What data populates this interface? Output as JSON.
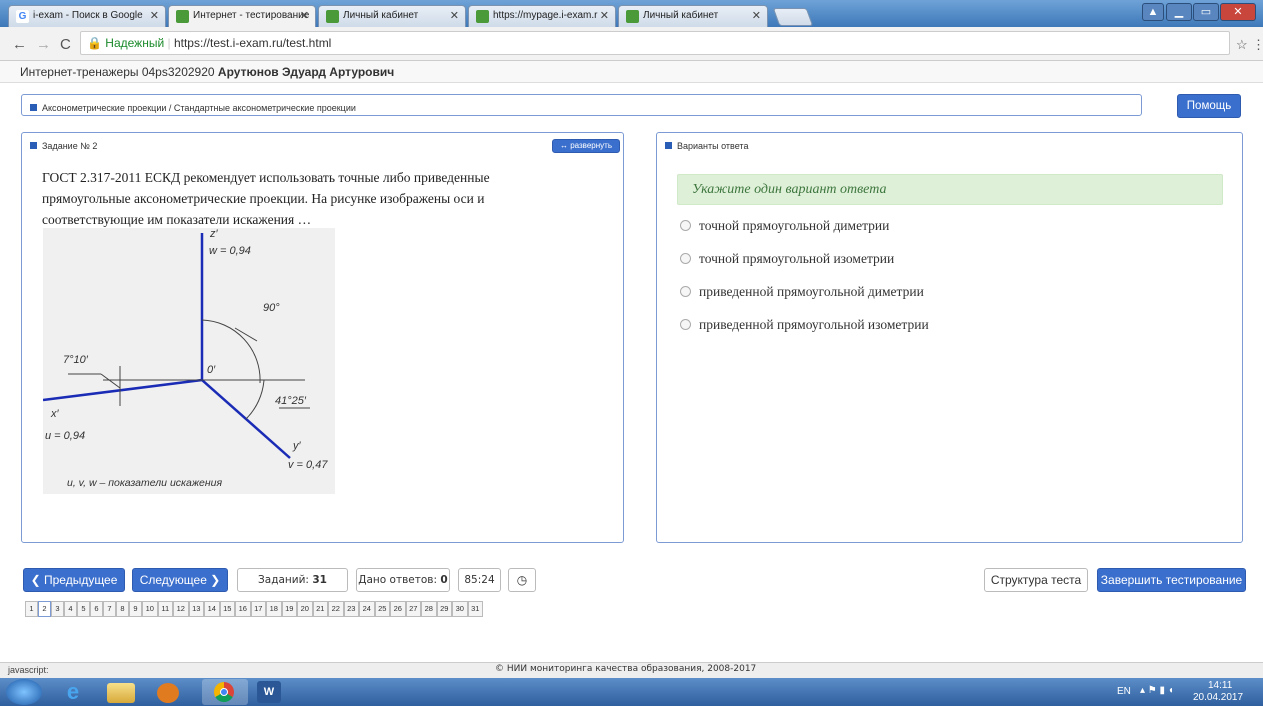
{
  "browser": {
    "tabs": [
      {
        "label": "i-exam - Поиск в Google"
      },
      {
        "label": "Интернет - тестирование"
      },
      {
        "label": "Личный кабинет"
      },
      {
        "label": "https://mypage.i-exam.r"
      },
      {
        "label": "Личный кабинет"
      }
    ],
    "secure_label": "Надежный",
    "url": "https://test.i-exam.ru/test.html"
  },
  "header": {
    "prefix": "Интернет-тренажеры 04ps3202920",
    "user_name": "Арутюнов Эдуард Артурович"
  },
  "breadcrumb": "Аксонометрические проекции / Стандартные аксонометрические проекции",
  "help_label": "Помощь",
  "task": {
    "title": "Задание № 2",
    "expand_label": "↔ развернуть",
    "question": "ГОСТ 2.317-2011 ЕСКД рекомендует использовать точные либо приведенные прямоугольные аксонометрические проекции. На рисунке изображены оси и соответствующие им показатели искажения …",
    "figure": {
      "z": "z′",
      "w": "w = 0,94",
      "angle90": "90°",
      "origin": "0′",
      "angle7": "7°10′",
      "angle41": "41°25′",
      "x": "x′",
      "u": "u = 0,94",
      "y": "y′",
      "v": "v = 0,47",
      "caption": "u, v, w – показатели искажения"
    }
  },
  "answers": {
    "title": "Варианты ответа",
    "hint": "Укажите один вариант ответа",
    "options": [
      "точной прямоугольной диметрии",
      "точной прямоугольной изометрии",
      "приведенной прямоугольной диметрии",
      "приведенной прямоугольной изометрии"
    ]
  },
  "nav": {
    "prev": "❮ Предыдущее",
    "next": "Следующее ❯",
    "tasks_label": "Заданий:",
    "tasks_count": "31",
    "answered_label": "Дано ответов:",
    "answered_count": "0",
    "timer": "85:24",
    "structure": "Структура теста",
    "finish": "Завершить тестирование",
    "pages": [
      "1",
      "2",
      "3",
      "4",
      "5",
      "6",
      "7",
      "8",
      "9",
      "10",
      "11",
      "12",
      "13",
      "14",
      "15",
      "16",
      "17",
      "18",
      "19",
      "20",
      "21",
      "22",
      "23",
      "24",
      "25",
      "26",
      "27",
      "28",
      "29",
      "30",
      "31"
    ],
    "current_page": 2
  },
  "footer": "© НИИ мониторинга качества образования, 2008-2017",
  "status_text": "javascript:",
  "taskbar": {
    "lang": "EN",
    "time": "14:11",
    "date": "20.04.2017"
  },
  "colors": {
    "accent": "#3b6fcd",
    "panel_border": "#7c9ad3",
    "hint_bg": "#dff0d8",
    "hint_text": "#3c763d"
  }
}
